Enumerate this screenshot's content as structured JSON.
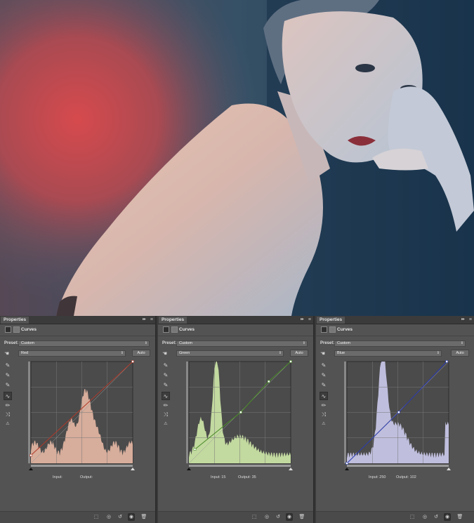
{
  "colors": {
    "panel_bg": "#535353",
    "red_fill": "#e7b8a4",
    "green_fill": "#cfe9a9",
    "blue_fill": "#cccbed",
    "red_line": "#b03a2a",
    "green_line": "#4b8c2a",
    "blue_line": "#2a3ab0"
  },
  "panels": [
    {
      "tab": "Properties",
      "title": "Curves",
      "preset_label": "Preset:",
      "preset_value": "Custom",
      "channel": "Red",
      "auto_label": "Auto",
      "input_label": "Input:",
      "input_value": "",
      "output_label": "Output:",
      "output_value": ""
    },
    {
      "tab": "Properties",
      "title": "Curves",
      "preset_label": "Preset:",
      "preset_value": "Custom",
      "channel": "Green",
      "auto_label": "Auto",
      "input_label": "Input:",
      "input_value": "15",
      "output_label": "Output:",
      "output_value": "35"
    },
    {
      "tab": "Properties",
      "title": "Curves",
      "preset_label": "Preset:",
      "preset_value": "Custom",
      "channel": "Blue",
      "auto_label": "Auto",
      "input_label": "Input:",
      "input_value": "250",
      "output_label": "Output:",
      "output_value": "102"
    }
  ],
  "chart_data": [
    {
      "type": "line",
      "channel": "Red",
      "xlim": [
        0,
        255
      ],
      "ylim": [
        0,
        255
      ],
      "curve_points": [
        [
          0,
          20
        ],
        [
          255,
          255
        ]
      ]
    },
    {
      "type": "line",
      "channel": "Green",
      "xlim": [
        0,
        255
      ],
      "ylim": [
        0,
        255
      ],
      "curve_points": [
        [
          15,
          35
        ],
        [
          130,
          128
        ],
        [
          200,
          205
        ],
        [
          255,
          255
        ]
      ]
    },
    {
      "type": "line",
      "channel": "Blue",
      "xlim": [
        0,
        255
      ],
      "ylim": [
        0,
        255
      ],
      "curve_points": [
        [
          0,
          0
        ],
        [
          130,
          128
        ],
        [
          250,
          255
        ]
      ]
    }
  ],
  "tools": [
    "sample-in-image-icon",
    "black-point-eyedropper-icon",
    "gray-point-eyedropper-icon",
    "white-point-eyedropper-icon",
    "curve-point-icon",
    "pencil-icon",
    "smooth-icon",
    "clipping-warning-icon"
  ],
  "bottom_icons": [
    "clip-to-layer-icon",
    "view-previous-icon",
    "reset-icon",
    "visibility-eye-icon",
    "trash-icon"
  ]
}
